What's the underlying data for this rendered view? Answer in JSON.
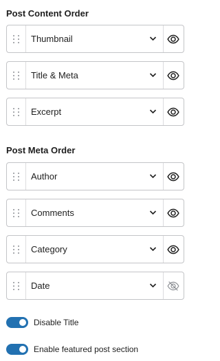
{
  "post_content": {
    "title": "Post Content Order",
    "items": [
      {
        "label": "Thumbnail",
        "icon": "eye-icon",
        "visible": true
      },
      {
        "label": "Title & Meta",
        "icon": "eye-icon",
        "visible": true
      },
      {
        "label": "Excerpt",
        "icon": "eye-icon",
        "visible": true
      }
    ]
  },
  "post_meta": {
    "title": "Post Meta Order",
    "items": [
      {
        "label": "Author",
        "icon": "eye-icon",
        "visible": true
      },
      {
        "label": "Comments",
        "icon": "eye-icon",
        "visible": true
      },
      {
        "label": "Category",
        "icon": "eye-icon",
        "visible": true
      },
      {
        "label": "Date",
        "icon": "eye-off-icon",
        "visible": false
      }
    ]
  },
  "toggles": [
    {
      "label": "Disable Title",
      "on": true
    },
    {
      "label": "Enable featured post section",
      "on": true
    }
  ],
  "colors": {
    "accent": "#2271b1",
    "border": "#c3c4c7",
    "icon_off": "#8c8f94"
  }
}
